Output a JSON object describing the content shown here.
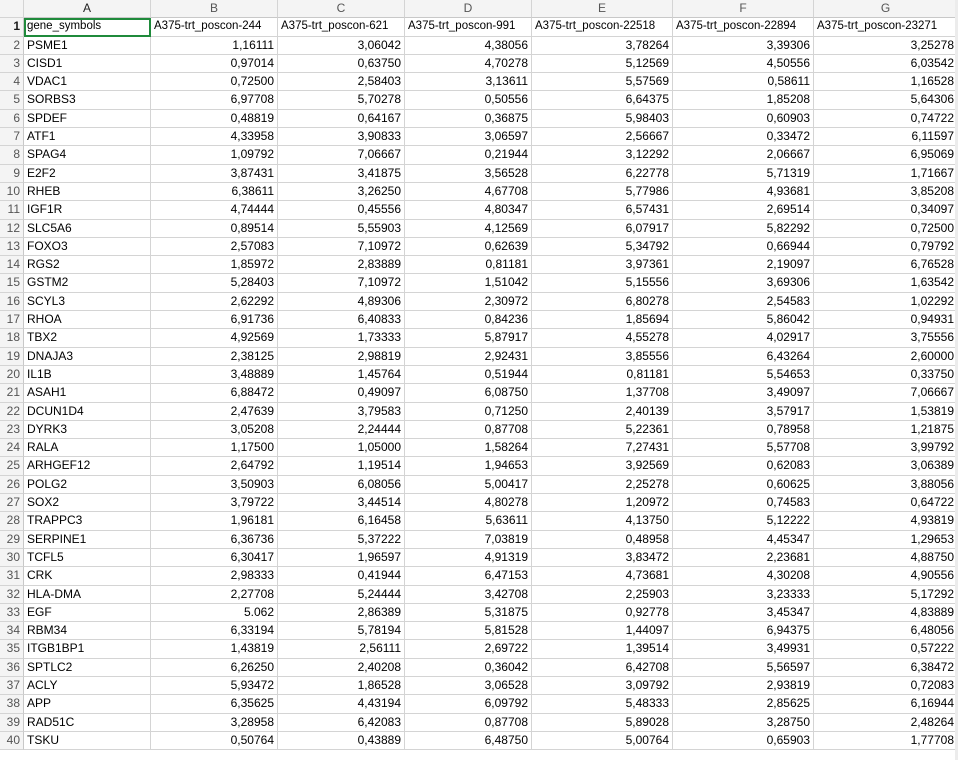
{
  "spreadsheet": {
    "column_letters": [
      "A",
      "B",
      "C",
      "D",
      "E",
      "F",
      "G"
    ],
    "selected_cell": "A1",
    "header_row": [
      "gene_symbols",
      "A375-trt_poscon-244",
      "A375-trt_poscon-621",
      "A375-trt_poscon-991",
      "A375-trt_poscon-22518",
      "A375-trt_poscon-22894",
      "A375-trt_poscon-23271"
    ],
    "rows": [
      {
        "n": "2",
        "cells": [
          "PSME1",
          "1,16111",
          "3,06042",
          "4,38056",
          "3,78264",
          "3,39306",
          "3,25278"
        ]
      },
      {
        "n": "3",
        "cells": [
          "CISD1",
          "0,97014",
          "0,63750",
          "4,70278",
          "5,12569",
          "4,50556",
          "6,03542"
        ]
      },
      {
        "n": "4",
        "cells": [
          "VDAC1",
          "0,72500",
          "2,58403",
          "3,13611",
          "5,57569",
          "0,58611",
          "1,16528"
        ]
      },
      {
        "n": "5",
        "cells": [
          "SORBS3",
          "6,97708",
          "5,70278",
          "0,50556",
          "6,64375",
          "1,85208",
          "5,64306"
        ]
      },
      {
        "n": "6",
        "cells": [
          "SPDEF",
          "0,48819",
          "0,64167",
          "0,36875",
          "5,98403",
          "0,60903",
          "0,74722"
        ]
      },
      {
        "n": "7",
        "cells": [
          "ATF1",
          "4,33958",
          "3,90833",
          "3,06597",
          "2,56667",
          "0,33472",
          "6,11597"
        ]
      },
      {
        "n": "8",
        "cells": [
          "SPAG4",
          "1,09792",
          "7,06667",
          "0,21944",
          "3,12292",
          "2,06667",
          "6,95069"
        ]
      },
      {
        "n": "9",
        "cells": [
          "E2F2",
          "3,87431",
          "3,41875",
          "3,56528",
          "6,22778",
          "5,71319",
          "1,71667"
        ]
      },
      {
        "n": "10",
        "cells": [
          "RHEB",
          "6,38611",
          "3,26250",
          "4,67708",
          "5,77986",
          "4,93681",
          "3,85208"
        ]
      },
      {
        "n": "11",
        "cells": [
          "IGF1R",
          "4,74444",
          "0,45556",
          "4,80347",
          "6,57431",
          "2,69514",
          "0,34097"
        ]
      },
      {
        "n": "12",
        "cells": [
          "SLC5A6",
          "0,89514",
          "5,55903",
          "4,12569",
          "6,07917",
          "5,82292",
          "0,72500"
        ]
      },
      {
        "n": "13",
        "cells": [
          "FOXO3",
          "2,57083",
          "7,10972",
          "0,62639",
          "5,34792",
          "0,66944",
          "0,79792"
        ]
      },
      {
        "n": "14",
        "cells": [
          "RGS2",
          "1,85972",
          "2,83889",
          "0,81181",
          "3,97361",
          "2,19097",
          "6,76528"
        ]
      },
      {
        "n": "15",
        "cells": [
          "GSTM2",
          "5,28403",
          "7,10972",
          "1,51042",
          "5,15556",
          "3,69306",
          "1,63542"
        ]
      },
      {
        "n": "16",
        "cells": [
          "SCYL3",
          "2,62292",
          "4,89306",
          "2,30972",
          "6,80278",
          "2,54583",
          "1,02292"
        ]
      },
      {
        "n": "17",
        "cells": [
          "RHOA",
          "6,91736",
          "6,40833",
          "0,84236",
          "1,85694",
          "5,86042",
          "0,94931"
        ]
      },
      {
        "n": "18",
        "cells": [
          "TBX2",
          "4,92569",
          "1,73333",
          "5,87917",
          "4,55278",
          "4,02917",
          "3,75556"
        ]
      },
      {
        "n": "19",
        "cells": [
          "DNAJA3",
          "2,38125",
          "2,98819",
          "2,92431",
          "3,85556",
          "6,43264",
          "2,60000"
        ]
      },
      {
        "n": "20",
        "cells": [
          "IL1B",
          "3,48889",
          "1,45764",
          "0,51944",
          "0,81181",
          "5,54653",
          "0,33750"
        ]
      },
      {
        "n": "21",
        "cells": [
          "ASAH1",
          "6,88472",
          "0,49097",
          "6,08750",
          "1,37708",
          "3,49097",
          "7,06667"
        ]
      },
      {
        "n": "22",
        "cells": [
          "DCUN1D4",
          "2,47639",
          "3,79583",
          "0,71250",
          "2,40139",
          "3,57917",
          "1,53819"
        ]
      },
      {
        "n": "23",
        "cells": [
          "DYRK3",
          "3,05208",
          "2,24444",
          "0,87708",
          "5,22361",
          "0,78958",
          "1,21875"
        ]
      },
      {
        "n": "24",
        "cells": [
          "RALA",
          "1,17500",
          "1,05000",
          "1,58264",
          "7,27431",
          "5,57708",
          "3,99792"
        ]
      },
      {
        "n": "25",
        "cells": [
          "ARHGEF12",
          "2,64792",
          "1,19514",
          "1,94653",
          "3,92569",
          "0,62083",
          "3,06389"
        ]
      },
      {
        "n": "26",
        "cells": [
          "POLG2",
          "3,50903",
          "6,08056",
          "5,00417",
          "2,25278",
          "0,60625",
          "3,88056"
        ]
      },
      {
        "n": "27",
        "cells": [
          "SOX2",
          "3,79722",
          "3,44514",
          "4,80278",
          "1,20972",
          "0,74583",
          "0,64722"
        ]
      },
      {
        "n": "28",
        "cells": [
          "TRAPPC3",
          "1,96181",
          "6,16458",
          "5,63611",
          "4,13750",
          "5,12222",
          "4,93819"
        ]
      },
      {
        "n": "29",
        "cells": [
          "SERPINE1",
          "6,36736",
          "5,37222",
          "7,03819",
          "0,48958",
          "4,45347",
          "1,29653"
        ]
      },
      {
        "n": "30",
        "cells": [
          "TCFL5",
          "6,30417",
          "1,96597",
          "4,91319",
          "3,83472",
          "2,23681",
          "4,88750"
        ]
      },
      {
        "n": "31",
        "cells": [
          "CRK",
          "2,98333",
          "0,41944",
          "6,47153",
          "4,73681",
          "4,30208",
          "4,90556"
        ]
      },
      {
        "n": "32",
        "cells": [
          "HLA-DMA",
          "2,27708",
          "5,24444",
          "3,42708",
          "2,25903",
          "3,23333",
          "5,17292"
        ]
      },
      {
        "n": "33",
        "cells": [
          "EGF",
          "5.062",
          "2,86389",
          "5,31875",
          "0,92778",
          "3,45347",
          "4,83889"
        ]
      },
      {
        "n": "34",
        "cells": [
          "RBM34",
          "6,33194",
          "5,78194",
          "5,81528",
          "1,44097",
          "6,94375",
          "6,48056"
        ]
      },
      {
        "n": "35",
        "cells": [
          "ITGB1BP1",
          "1,43819",
          "2,56111",
          "2,69722",
          "1,39514",
          "3,49931",
          "0,57222"
        ]
      },
      {
        "n": "36",
        "cells": [
          "SPTLC2",
          "6,26250",
          "2,40208",
          "0,36042",
          "6,42708",
          "5,56597",
          "6,38472"
        ]
      },
      {
        "n": "37",
        "cells": [
          "ACLY",
          "5,93472",
          "1,86528",
          "3,06528",
          "3,09792",
          "2,93819",
          "0,72083"
        ]
      },
      {
        "n": "38",
        "cells": [
          "APP",
          "6,35625",
          "4,43194",
          "6,09792",
          "5,48333",
          "2,85625",
          "6,16944"
        ]
      },
      {
        "n": "39",
        "cells": [
          "RAD51C",
          "3,28958",
          "6,42083",
          "0,87708",
          "5,89028",
          "3,28750",
          "2,48264"
        ]
      },
      {
        "n": "40",
        "cells": [
          "TSKU",
          "0,50764",
          "0,43889",
          "6,48750",
          "5,00764",
          "0,65903",
          "1,77708"
        ]
      }
    ]
  }
}
